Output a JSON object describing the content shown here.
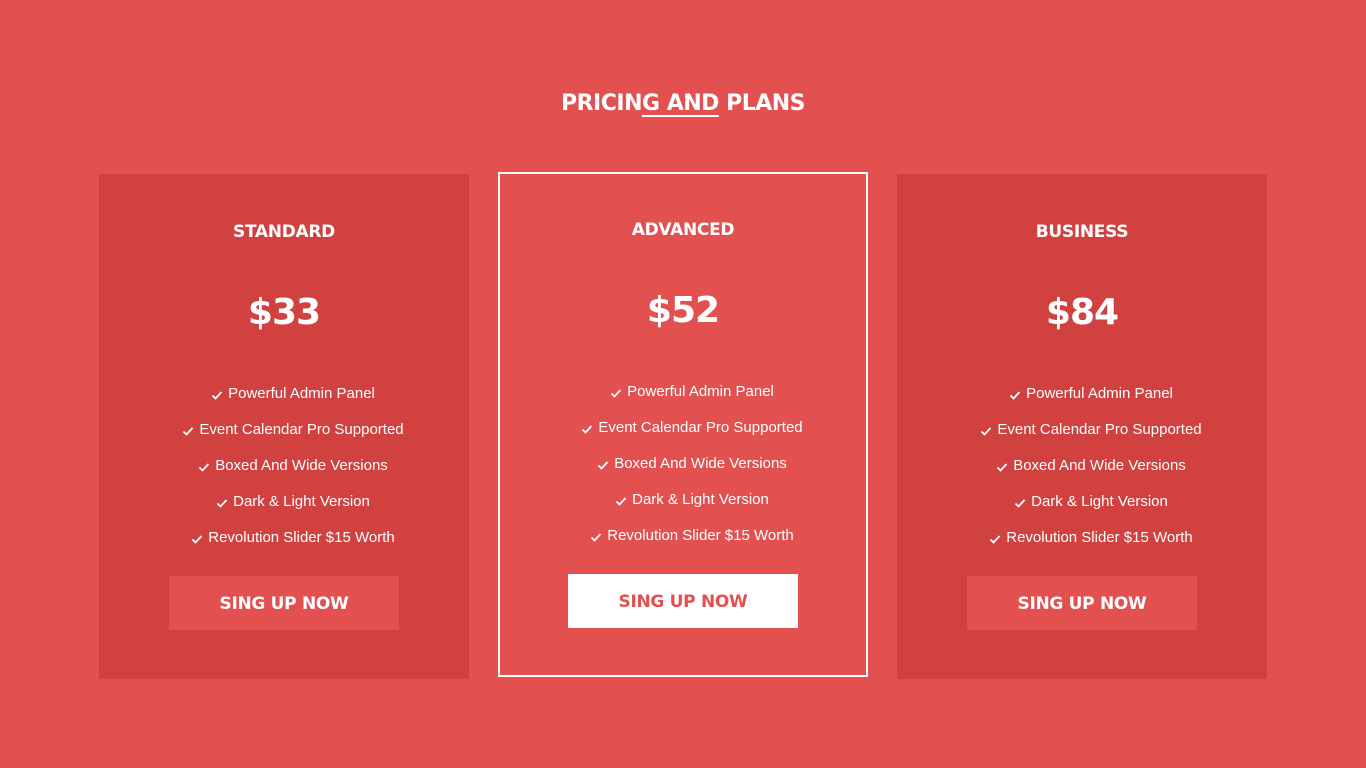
{
  "section": {
    "title_before": "PRICIN",
    "title_underlined": "G AND",
    "title_after": " PLANS"
  },
  "plans": [
    {
      "name": "STANDARD",
      "price": "$33",
      "features": [
        "Powerful Admin Panel",
        "Event Calendar Pro Supported",
        "Boxed And Wide Versions",
        "Dark & Light Version",
        "Revolution Slider $15 Worth"
      ],
      "button_label": "SING UP NOW"
    },
    {
      "name": "ADVANCED",
      "price": "$52",
      "features": [
        "Powerful Admin Panel",
        "Event Calendar Pro Supported",
        "Boxed And Wide Versions",
        "Dark & Light Version",
        "Revolution Slider $15 Worth"
      ],
      "button_label": "SING UP NOW"
    },
    {
      "name": "BUSINESS",
      "price": "$84",
      "features": [
        "Powerful Admin Panel",
        "Event Calendar Pro Supported",
        "Boxed And Wide Versions",
        "Dark & Light Version",
        "Revolution Slider $15 Worth"
      ],
      "button_label": "SING UP NOW"
    }
  ],
  "colors": {
    "background": "#e25150",
    "card": "#d04140",
    "text": "#ffffff"
  },
  "icons": {
    "feature_bullet": "check-icon"
  }
}
